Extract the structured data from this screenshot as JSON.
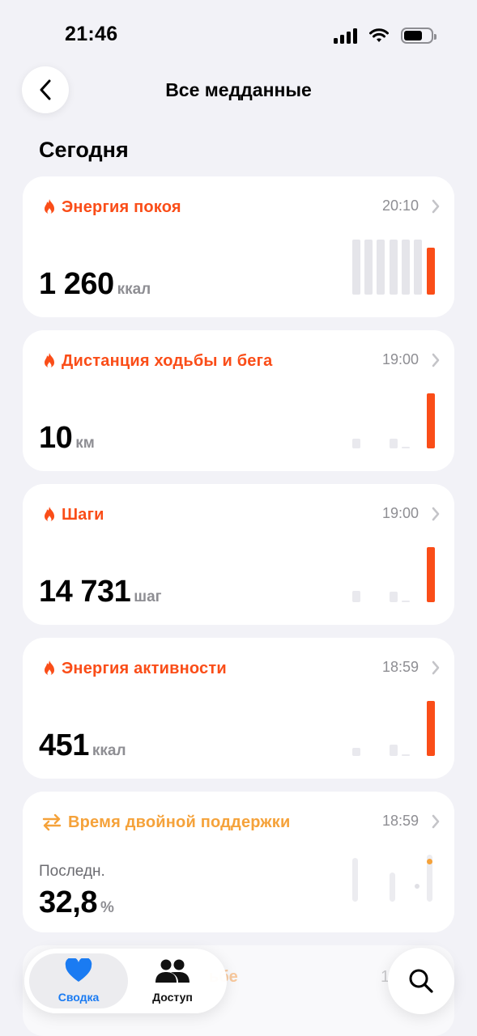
{
  "status_bar": {
    "time": "21:46"
  },
  "nav": {
    "title": "Все медданные"
  },
  "section": {
    "title": "Сегодня"
  },
  "cards": [
    {
      "title": "Энергия покоя",
      "time": "20:10",
      "value": "1 260",
      "unit": "ккал",
      "icon": "flame-icon"
    },
    {
      "title": "Дистанция ходьбы и бега",
      "time": "19:00",
      "value": "10",
      "unit": "км",
      "icon": "flame-icon"
    },
    {
      "title": "Шаги",
      "time": "19:00",
      "value": "14 731",
      "unit": "шаг",
      "icon": "flame-icon"
    },
    {
      "title": "Энергия активности",
      "time": "18:59",
      "value": "451",
      "unit": "ккал",
      "icon": "flame-icon"
    },
    {
      "title": "Время двойной поддержки",
      "time": "18:59",
      "sublabel": "Последн.",
      "value": "32,8",
      "unit": "%",
      "icon": "double-support-icon"
    }
  ],
  "partial_card": {
    "title_fragment": "ьбе",
    "time_fragment": "1"
  },
  "tabbar": {
    "tabs": [
      {
        "label": "Сводка",
        "icon": "heart-icon",
        "active": true
      },
      {
        "label": "Доступ",
        "icon": "people-icon",
        "active": false
      }
    ]
  },
  "colors": {
    "accent_orange": "#fa4d18",
    "light_orange": "#f5a23a",
    "tab_active": "#1a7bf2",
    "bar_gray": "#e5e5ea",
    "background": "#f2f2f7"
  }
}
